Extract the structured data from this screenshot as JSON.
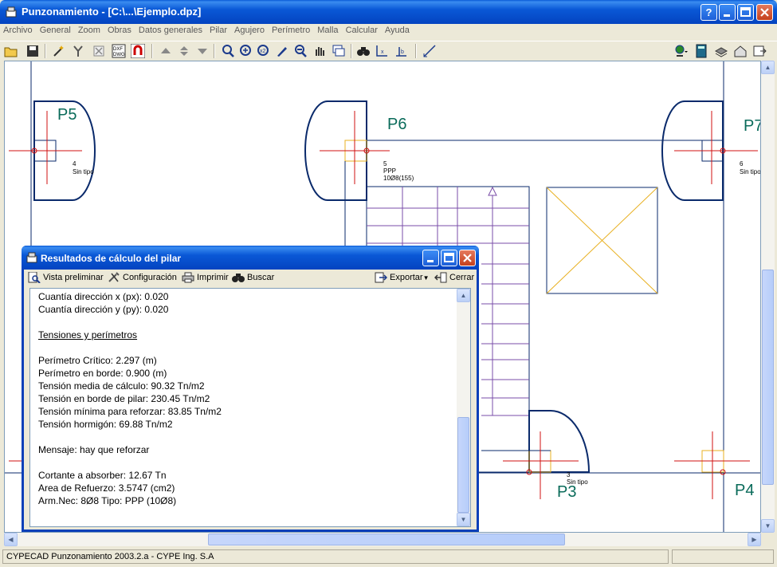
{
  "window": {
    "title": "Punzonamiento - [C:\\...\\Ejemplo.dpz]"
  },
  "title_buttons": {
    "help": "?",
    "minimize": "_",
    "maximize": "□",
    "close": "✕"
  },
  "menu": [
    "Archivo",
    "General",
    "Zoom",
    "Obras",
    "Datos generales",
    "Pilar",
    "Agujero",
    "Perímetro",
    "Malla",
    "Calcular",
    "Ayuda"
  ],
  "drawing": {
    "labels": {
      "p5": "P5",
      "p6": "P6",
      "p7": "P7",
      "p3": "P3",
      "p4": "P4",
      "n4": "4",
      "n5": "5",
      "n6": "6",
      "n3": "3",
      "sintipo": "Sin tipo",
      "sintipo_cut": "Sin tipo",
      "ppp": "PPP",
      "arm": "10Ø8(155)"
    }
  },
  "results_window": {
    "title": "Resultados de cálculo del pilar",
    "toolbar": {
      "preview": "Vista preliminar",
      "config": "Configuración",
      "print": "Imprimir",
      "search": "Buscar",
      "export": "Exportar",
      "close": "Cerrar"
    },
    "lines": [
      "Cuantía dirección x (px): 0.020",
      "Cuantía dirección y (py): 0.020",
      "",
      "Tensiones y perímetros",
      "",
      "Perímetro Crítico: 2.297 (m)",
      "Perímetro en borde: 0.900 (m)",
      "Tensión media de cálculo: 90.32 Tn/m2",
      "Tensión en borde de pilar: 230.45 Tn/m2",
      "Tensión mínima para reforzar: 83.85 Tn/m2",
      "Tensión hormigón: 69.88 Tn/m2",
      "",
      "Mensaje: hay que reforzar",
      "",
      "Cortante a absorber: 12.67 Tn",
      "Area de Refuerzo: 3.5747 (cm2)",
      "Arm.Nec: 8Ø8 Tipo: PPP (10Ø8)"
    ],
    "underline_index": 3
  },
  "status": {
    "text": "CYPECAD Punzonamiento 2003.2.a - CYPE Ing. S.A"
  },
  "colors": {
    "title_blue": "#0a58d6",
    "drawing_navy": "#0a2a6b",
    "red": "#d01010",
    "stair_purple": "#7a4ea8",
    "hole_yellow": "#e8b020"
  }
}
